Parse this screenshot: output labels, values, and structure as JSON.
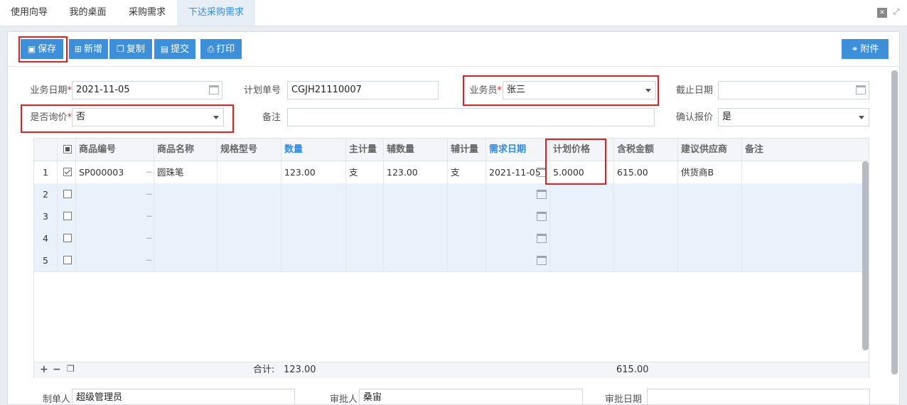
{
  "tabs": [
    "使用向导",
    "我的桌面",
    "采购需求",
    "下达采购需求"
  ],
  "toolbar": {
    "save": "保存",
    "add": "新增",
    "copy": "复制",
    "submit": "提交",
    "print": "打印",
    "attach": "附件"
  },
  "form": {
    "biz_date_label": "业务日期",
    "biz_date": "2021-11-05",
    "plan_no_label": "计划单号",
    "plan_no": "CGJH21110007",
    "salesman_label": "业务员",
    "salesman": "张三",
    "deadline_label": "截止日期",
    "deadline": "",
    "inquiry_label": "是否询价",
    "inquiry": "否",
    "remark_label": "备注",
    "remark": "",
    "confirm_label": "确认报价",
    "confirm": "是",
    "required_mark": "*"
  },
  "table": {
    "headers": [
      "商品编号",
      "商品名称",
      "规格型号",
      "数量",
      "主计量",
      "辅数量",
      "辅计量",
      "需求日期",
      "计划价格",
      "含税金额",
      "建议供应商",
      "备注"
    ],
    "rows": [
      {
        "no": "1",
        "code": "SP000003",
        "name": "圆珠笔",
        "spec": "",
        "qty": "123.00",
        "unit": "支",
        "aux_qty": "123.00",
        "aux_unit": "支",
        "date": "2021-11-05",
        "price": "5.0000",
        "amount": "615.00",
        "supplier": "供货商B",
        "note": ""
      },
      {
        "no": "2"
      },
      {
        "no": "3"
      },
      {
        "no": "4"
      },
      {
        "no": "5"
      }
    ],
    "total_label": "合计:",
    "total_qty": "123.00",
    "total_amount": "615.00",
    "more_glyph": "···"
  },
  "bottom": {
    "maker_label": "制单人",
    "maker": "超级管理员",
    "approver_label": "审批人",
    "approver": "桑宙",
    "approve_date_label": "审批日期",
    "approve_date": ""
  }
}
